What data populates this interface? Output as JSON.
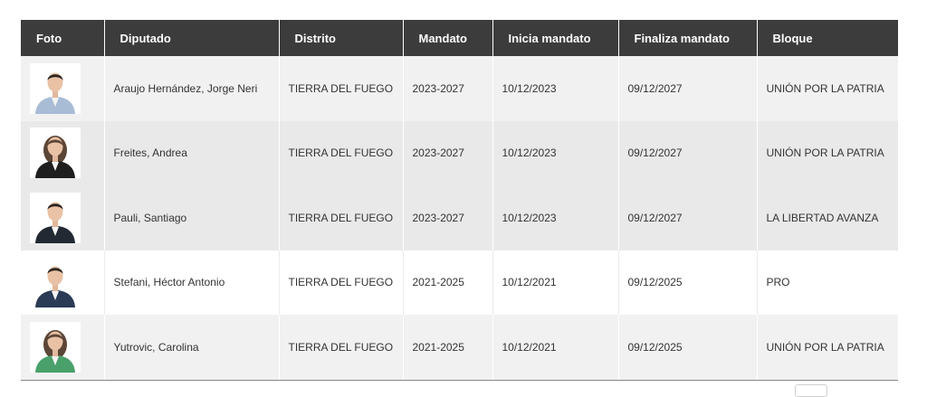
{
  "table": {
    "headers": [
      "Foto",
      "Diputado",
      "Distrito",
      "Mandato",
      "Inicia mandato",
      "Finaliza mandato",
      "Bloque"
    ],
    "rows": [
      {
        "diputado": "Araujo Hernández, Jorge Neri",
        "distrito": "TIERRA DEL FUEGO",
        "mandato": "2023-2027",
        "inicia": "10/12/2023",
        "finaliza": "09/12/2027",
        "bloque": "UNIÓN POR LA PATRIA",
        "photo_icon": "portrait-man-light-shirt",
        "jacket_color": "#a9bcd6"
      },
      {
        "diputado": "Freites, Andrea",
        "distrito": "TIERRA DEL FUEGO",
        "mandato": "2023-2027",
        "inicia": "10/12/2023",
        "finaliza": "09/12/2027",
        "bloque": "UNIÓN POR LA PATRIA",
        "photo_icon": "portrait-woman-dark-jacket",
        "jacket_color": "#1e1e1e"
      },
      {
        "diputado": "Pauli, Santiago",
        "distrito": "TIERRA DEL FUEGO",
        "mandato": "2023-2027",
        "inicia": "10/12/2023",
        "finaliza": "09/12/2027",
        "bloque": "LA LIBERTAD AVANZA",
        "photo_icon": "portrait-man-dark-suit",
        "jacket_color": "#222933"
      },
      {
        "diputado": "Stefani, Héctor Antonio",
        "distrito": "TIERRA DEL FUEGO",
        "mandato": "2021-2025",
        "inicia": "10/12/2021",
        "finaliza": "09/12/2025",
        "bloque": "PRO",
        "photo_icon": "portrait-man-navy-suit",
        "jacket_color": "#2b3a55"
      },
      {
        "diputado": "Yutrovic, Carolina",
        "distrito": "TIERRA DEL FUEGO",
        "mandato": "2021-2025",
        "inicia": "10/12/2021",
        "finaliza": "09/12/2025",
        "bloque": "UNIÓN POR LA PATRIA",
        "photo_icon": "portrait-woman-green-jacket",
        "jacket_color": "#4aa06b"
      }
    ]
  },
  "colors": {
    "header_bg": "#3c3c3c",
    "header_text": "#ffffff",
    "row_shade_a": "#f1f1f1",
    "row_shade_b": "#e9e9e9",
    "row_shade_c": "#ffffff"
  }
}
